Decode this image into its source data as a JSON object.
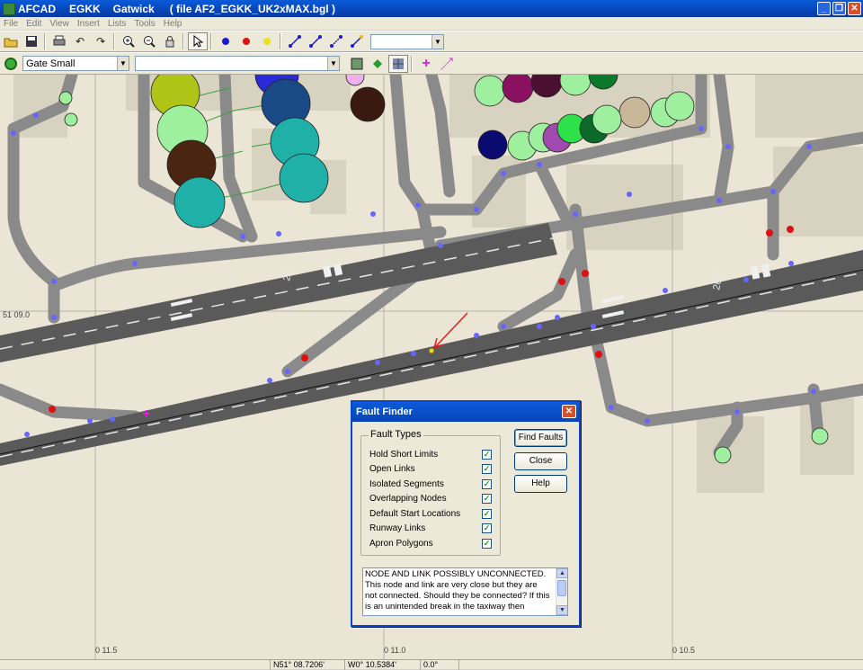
{
  "window": {
    "title_parts": [
      "AFCAD",
      "EGKK",
      "Gatwick",
      "( file AF2_EGKK_UK2xMAX.bgl )"
    ],
    "buttons": [
      "_",
      "❐",
      "✕"
    ]
  },
  "menu": [
    "File",
    "Edit",
    "View",
    "Insert",
    "Lists",
    "Tools",
    "Help"
  ],
  "toolbar2": {
    "gate_type": "Gate Small",
    "name_combo": ""
  },
  "map": {
    "lat_label": "51 09.0",
    "lon_labels": [
      "0 11.5",
      "0 11.0",
      "0 10.5"
    ],
    "runway_marks": [
      "26L",
      "26R"
    ]
  },
  "status": {
    "lat": "N51° 08.7206'",
    "lon": "W0° 10.5384'",
    "heading": "0.0°"
  },
  "dialog": {
    "title": "Fault Finder",
    "group_label": "Fault Types",
    "fault_types": [
      {
        "label": "Hold Short Limits",
        "checked": true
      },
      {
        "label": "Open Links",
        "checked": true
      },
      {
        "label": "Isolated Segments",
        "checked": true
      },
      {
        "label": "Overlapping Nodes",
        "checked": true
      },
      {
        "label": "Default Start Locations",
        "checked": true
      },
      {
        "label": "Runway Links",
        "checked": true
      },
      {
        "label": "Apron Polygons",
        "checked": true
      }
    ],
    "buttons": {
      "find": "Find Faults",
      "close": "Close",
      "help": "Help"
    },
    "message": "NODE AND LINK POSSIBLY UNCONNECTED. This node and link are very close but they are not connected.  Should they be connected?  If this is an unintended break in the taxiway then"
  },
  "colors": {
    "title_blue": "#0a46c8",
    "taxiway": "#8a8a8a",
    "node": "#6666ff",
    "arrow": "#e02020"
  }
}
